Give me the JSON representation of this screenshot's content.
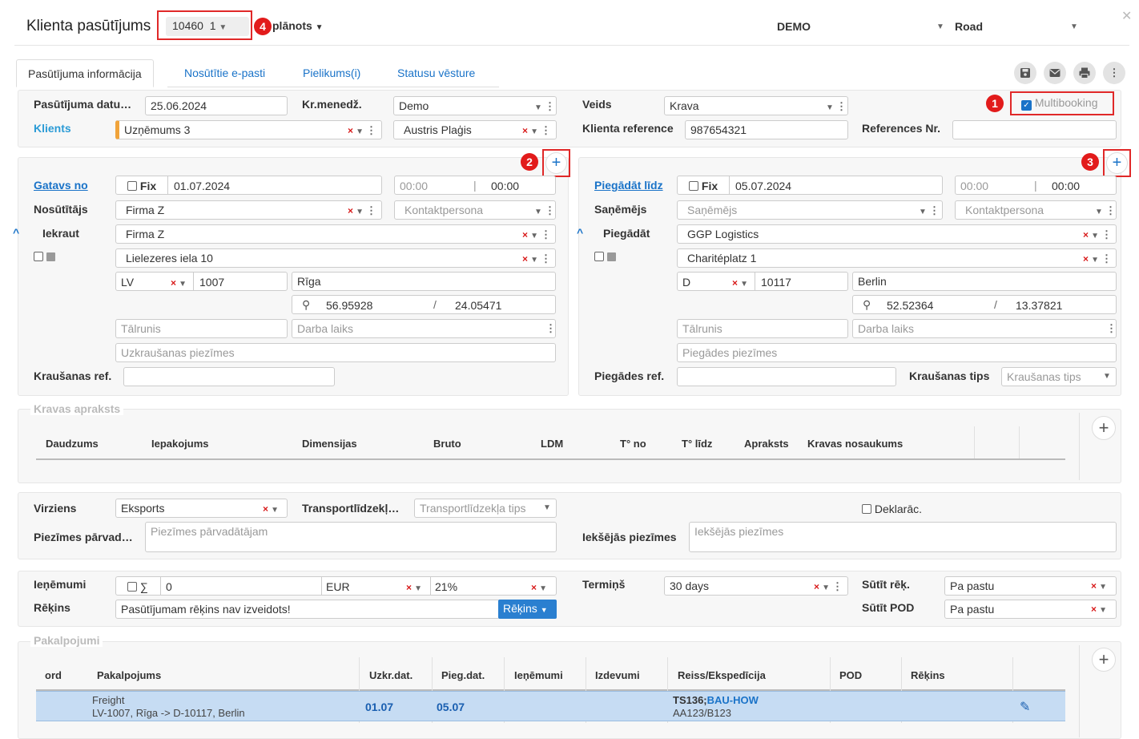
{
  "header": {
    "title": "Klienta pasūtījums",
    "order_no": "10460",
    "order_ver": "1",
    "status": "plānots",
    "company": "DEMO",
    "transport": "Road"
  },
  "tabs": [
    "Pasūtījuma informācija",
    "Nosūtītie e-pasti",
    "Pielikums(i)",
    "Statusu vēsture"
  ],
  "badges": [
    "1",
    "2",
    "3",
    "4"
  ],
  "top": {
    "order_date_label": "Pasūtījuma datu…",
    "order_date": "25.06.2024",
    "manager_label": "Kr.menedž.",
    "manager": "Demo",
    "type_label": "Veids",
    "type": "Krava",
    "multibooking": "Multibooking",
    "client_label": "Klients",
    "client": "Uzņēmums 3",
    "contact": "Austris Plaģis",
    "client_ref_label": "Klienta reference",
    "client_ref": "987654321",
    "ref_no_label": "References Nr.",
    "ref_no": ""
  },
  "pickup": {
    "ready_label": "Gatavs no",
    "fix": "Fix",
    "date": "01.07.2024",
    "time_from": "00:00",
    "time_to": "00:00",
    "sender_label": "Nosūtītājs",
    "sender": "Firma Z",
    "contact_ph": "Kontaktpersona",
    "load_label": "Iekraut",
    "load": "Firma Z",
    "address": "Lielezeres iela 10",
    "country": "LV",
    "zip": "1007",
    "city": "Rīga",
    "lat": "56.95928",
    "lon": "24.05471",
    "phone_ph": "Tālrunis",
    "hours_ph": "Darba laiks",
    "notes_ph": "Uzkraušanas piezīmes",
    "ref_label": "Kraušanas ref.",
    "ref": ""
  },
  "delivery": {
    "until_label": "Piegādāt līdz",
    "fix": "Fix",
    "date": "05.07.2024",
    "time_from": "00:00",
    "time_to": "00:00",
    "receiver_label": "Saņēmējs",
    "receiver_ph": "Saņēmējs",
    "contact_ph": "Kontaktpersona",
    "deliver_label": "Piegādāt",
    "deliver": "GGP Logistics",
    "address": "Charitéplatz 1",
    "country": "D",
    "zip": "10117",
    "city": "Berlin",
    "lat": "52.52364",
    "lon": "13.37821",
    "phone_ph": "Tālrunis",
    "hours_ph": "Darba laiks",
    "notes_ph": "Piegādes piezīmes",
    "ref_label": "Piegādes ref.",
    "ref": "",
    "load_type_label": "Kraušanas tips",
    "load_type_ph": "Kraušanas tips"
  },
  "cargo": {
    "section": "Kravas apraksts",
    "columns": [
      "Daudzums",
      "Iepakojums",
      "Dimensijas",
      "Bruto",
      "LDM",
      "T° no",
      "T° līdz",
      "Apraksts",
      "Kravas nosaukums"
    ]
  },
  "misc": {
    "direction_label": "Virziens",
    "direction": "Eksports",
    "vehicle_label": "Transportlīdzekļ…",
    "vehicle_ph": "Transportlīdzekļa tips",
    "declaration": "Deklarāc.",
    "carrier_notes_label": "Piezīmes pārvad…",
    "carrier_notes_ph": "Piezīmes pārvadātājam",
    "internal_notes_label": "Iekšējās piezīmes",
    "internal_notes_ph": "Iekšējās piezīmes"
  },
  "finance": {
    "revenue_label": "Ieņēmumi",
    "sum_symbol": "∑",
    "amount": "0",
    "currency": "EUR",
    "vat": "21%",
    "term_label": "Termiņš",
    "term": "30 days",
    "send_invoice_label": "Sūtīt rēķ.",
    "send_invoice": "Pa pastu",
    "invoice_label": "Rēķins",
    "invoice_text": "Pasūtījumam rēķins nav izveidots!",
    "invoice_btn": "Rēķins",
    "send_pod_label": "Sūtīt POD",
    "send_pod": "Pa pastu"
  },
  "services": {
    "section": "Pakalpojumi",
    "columns": [
      "ord",
      "Pakalpojums",
      "Uzkr.dat.",
      "Pieg.dat.",
      "Ieņēmumi",
      "Izdevumi",
      "Reiss/Ekspedīcija",
      "POD",
      "Rēķins"
    ],
    "row": {
      "service": "Freight",
      "route": "LV-1007, Rīga -> D-10117, Berlin",
      "pickup": "01.07",
      "delivery": "05.07",
      "trip": "TS136;",
      "exp": "BAU-HOW",
      "trip_sub": "AA123/B123"
    }
  }
}
